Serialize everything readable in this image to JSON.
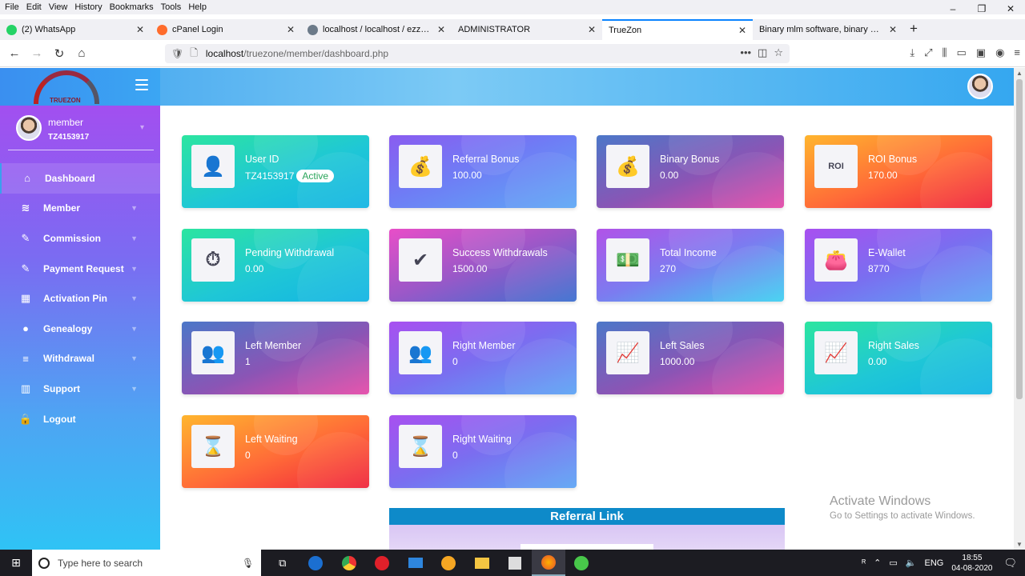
{
  "browser": {
    "menu": [
      "File",
      "Edit",
      "View",
      "History",
      "Bookmarks",
      "Tools",
      "Help"
    ],
    "tabs": [
      {
        "label": "(2) WhatsApp",
        "color": "#25d366"
      },
      {
        "label": "cPanel Login",
        "color": "#ff6c2c"
      },
      {
        "label": "localhost / localhost / ezzyeam",
        "color": "#6c7a89"
      },
      {
        "label": "ADMINISTRATOR",
        "color": ""
      },
      {
        "label": "TrueZon",
        "color": "",
        "active": true
      },
      {
        "label": "Binary mlm software, binary mlm so",
        "color": ""
      }
    ],
    "url_host": "localhost",
    "url_path": "/truezone/member/dashboard.php"
  },
  "app": {
    "logo_text": "TRUEZON",
    "user": {
      "name": "member",
      "id": "TZ4153917"
    },
    "nav": [
      {
        "label": "Dashboard",
        "icon": "home-icon",
        "glyph": "⌂",
        "active": true,
        "caret": false
      },
      {
        "label": "Member",
        "icon": "layers-icon",
        "glyph": "≋",
        "caret": true
      },
      {
        "label": "Commission",
        "icon": "edit-icon",
        "glyph": "✎",
        "caret": true
      },
      {
        "label": "Payment Request",
        "icon": "edit-icon",
        "glyph": "✎",
        "caret": true
      },
      {
        "label": "Activation Pin",
        "icon": "grid-icon",
        "glyph": "▦",
        "caret": true
      },
      {
        "label": "Genealogy",
        "icon": "user-icon",
        "glyph": "●",
        "caret": true
      },
      {
        "label": "Withdrawal",
        "icon": "list-icon",
        "glyph": "≡",
        "caret": true
      },
      {
        "label": "Support",
        "icon": "chart-icon",
        "glyph": "▥",
        "caret": true
      },
      {
        "label": "Logout",
        "icon": "lock-icon",
        "glyph": "🔒",
        "caret": false
      }
    ]
  },
  "cards": [
    {
      "title": "User ID",
      "value": "TZ4153917",
      "badge": "Active",
      "icon": "businessman-icon",
      "glyph": "👤",
      "gradient": "g-cyan"
    },
    {
      "title": "Referral Bonus",
      "value": "100.00",
      "icon": "coins-stack-icon",
      "glyph": "💰",
      "gradient": "g-blue"
    },
    {
      "title": "Binary Bonus",
      "value": "0.00",
      "icon": "money-bag-icon",
      "glyph": "💰",
      "gradient": "g-purple"
    },
    {
      "title": "ROI Bonus",
      "value": "170.00",
      "icon": "roi-icon",
      "glyph": "ROI",
      "gradient": "g-orange"
    },
    {
      "title": "Pending Withdrawal",
      "value": "0.00",
      "icon": "clock-money-icon",
      "glyph": "⏱",
      "gradient": "g-cyan"
    },
    {
      "title": "Success Withdrawals",
      "value": "1500.00",
      "icon": "check-icon",
      "glyph": "✔",
      "gradient": "g-pink"
    },
    {
      "title": "Total Income",
      "value": "270",
      "icon": "wallet-cash-icon",
      "glyph": "💵",
      "gradient": "g-sky"
    },
    {
      "title": "E-Wallet",
      "value": "8770",
      "icon": "wallet-icon",
      "glyph": "👛",
      "gradient": "g-violet"
    },
    {
      "title": "Left Member",
      "value": "1",
      "icon": "left-tree-icon",
      "glyph": "👥",
      "gradient": "g-purple"
    },
    {
      "title": "Right Member",
      "value": "0",
      "icon": "right-tree-icon",
      "glyph": "👥",
      "gradient": "g-violet"
    },
    {
      "title": "Left Sales",
      "value": "1000.00",
      "icon": "sales-chart-icon",
      "glyph": "📈",
      "gradient": "g-purple"
    },
    {
      "title": "Right Sales",
      "value": "0.00",
      "icon": "sales-chart-icon",
      "glyph": "📈",
      "gradient": "g-cyan"
    },
    {
      "title": "Left Waiting",
      "value": "0",
      "icon": "waiting-icon",
      "glyph": "⌛",
      "gradient": "g-orange"
    },
    {
      "title": "Right Waiting",
      "value": "0",
      "icon": "waiting-icon",
      "glyph": "⌛",
      "gradient": "g-violet"
    }
  ],
  "referral": {
    "title": "Referral Link"
  },
  "watermark": {
    "line1": "Activate Windows",
    "line2": "Go to Settings to activate Windows."
  },
  "taskbar": {
    "search_placeholder": "Type here to search",
    "lang": "ENG",
    "time": "18:55",
    "date": "04-08-2020"
  }
}
